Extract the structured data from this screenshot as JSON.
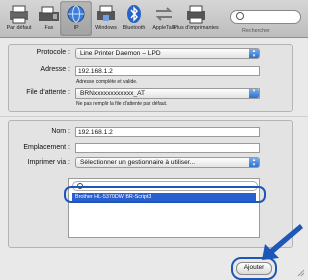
{
  "toolbar": {
    "items": [
      {
        "label": "Par défaut",
        "icon": "default-printer-icon"
      },
      {
        "label": "Fax",
        "icon": "fax-icon"
      },
      {
        "label": "IP",
        "icon": "ip-globe-icon"
      },
      {
        "label": "Windows",
        "icon": "windows-printer-icon"
      },
      {
        "label": "Bluetooth",
        "icon": "bluetooth-icon"
      },
      {
        "label": "AppleTalk",
        "icon": "appletalk-icon"
      },
      {
        "label": "Plus d'imprimantes",
        "icon": "more-printers-icon"
      }
    ],
    "search_placeholder": "",
    "search_label": "Rechercher"
  },
  "upper_panel": {
    "protocol_label": "Protocole :",
    "protocol_value": "Line Printer Daemon – LPD",
    "address_label": "Adresse :",
    "address_value": "192.168.1.2",
    "address_hint": "Adresse complète et valide.",
    "queue_label": "File d'attente :",
    "queue_value": "BRNxxxxxxxxxxxx_AT",
    "queue_hint": "Ne pas remplir la file d'attente par défaut."
  },
  "lower_panel": {
    "name_label": "Nom :",
    "name_value": "192.168.1.2",
    "location_label": "Emplacement :",
    "location_value": "",
    "print_using_label": "Imprimer via :",
    "print_using_value": "Sélectionner un gestionnaire à utiliser...",
    "driver_list_selected": "Brother HL-5370DW BR-Script3"
  },
  "add_button": "Ajouter",
  "accent_color": "#1d57b8"
}
